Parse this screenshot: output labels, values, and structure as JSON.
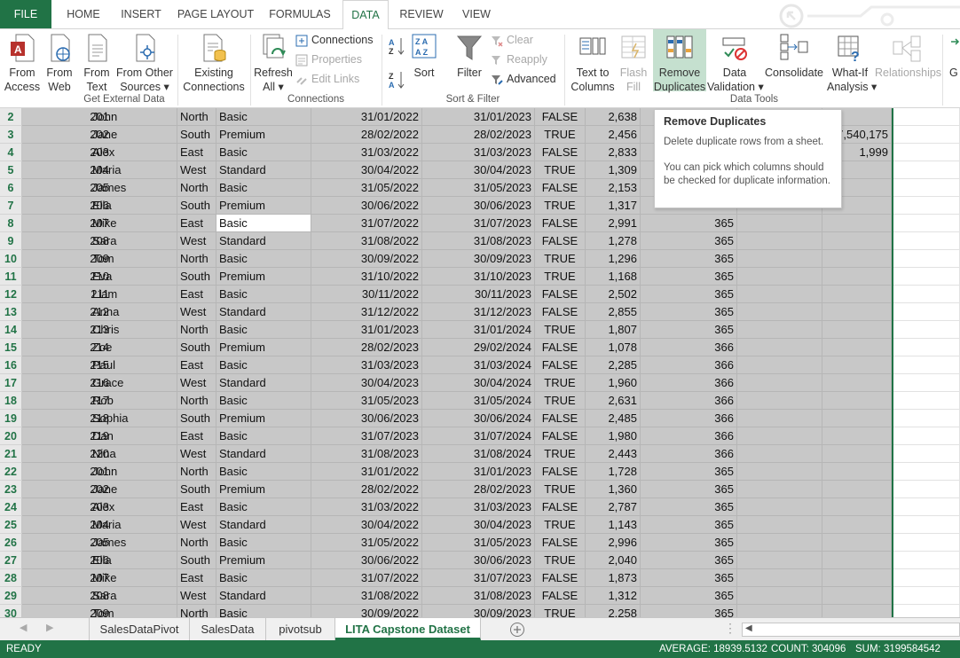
{
  "ribbon_tabs": [
    "FILE",
    "HOME",
    "INSERT",
    "PAGE LAYOUT",
    "FORMULAS",
    "DATA",
    "REVIEW",
    "VIEW"
  ],
  "ribbon": {
    "get_external": {
      "from_access": [
        "From",
        "Access"
      ],
      "from_web": [
        "From",
        "Web"
      ],
      "from_text": [
        "From",
        "Text"
      ],
      "from_other": [
        "From Other",
        "Sources ▾"
      ],
      "existing": [
        "Existing",
        "Connections"
      ],
      "label": "Get External Data"
    },
    "connections": {
      "refresh": [
        "Refresh",
        "All ▾"
      ],
      "connections": "Connections",
      "properties": "Properties",
      "edit_links": "Edit Links",
      "label": "Connections"
    },
    "sort_filter": {
      "sort": "Sort",
      "filter": "Filter",
      "clear": "Clear",
      "reapply": "Reapply",
      "advanced": "Advanced",
      "label": "Sort & Filter"
    },
    "data_tools": {
      "text_to_columns": [
        "Text to",
        "Columns"
      ],
      "flash_fill": [
        "Flash",
        "Fill"
      ],
      "remove_duplicates": [
        "Remove",
        "Duplicates"
      ],
      "data_validation": [
        "Data",
        "Validation ▾"
      ],
      "consolidate": "Consolidate",
      "what_if": [
        "What-If",
        "Analysis ▾"
      ],
      "relationships": "Relationships",
      "label": "Data Tools"
    },
    "group_partial": "G"
  },
  "tooltip": {
    "title": "Remove Duplicates",
    "body": "Delete duplicate rows from a sheet.",
    "body2": "You can pick which columns should be checked for duplicate information."
  },
  "rows": [
    {
      "n": "2",
      "id": "201",
      "name": "John",
      "region": "North",
      "plan": "Basic",
      "start": "31/01/2022",
      "end": "31/01/2023",
      "flag": "FALSE",
      "amount": "2,638",
      "days": "",
      "extra": ""
    },
    {
      "n": "3",
      "id": "202",
      "name": "Jane",
      "region": "South",
      "plan": "Premium",
      "start": "28/02/2022",
      "end": "28/02/2023",
      "flag": "TRUE",
      "amount": "2,456",
      "days": "",
      "extra": "7,540,175"
    },
    {
      "n": "4",
      "id": "203",
      "name": "Alex",
      "region": "East",
      "plan": "Basic",
      "start": "31/03/2022",
      "end": "31/03/2023",
      "flag": "FALSE",
      "amount": "2,833",
      "days": "",
      "extra": "1,999"
    },
    {
      "n": "5",
      "id": "204",
      "name": "Maria",
      "region": "West",
      "plan": "Standard",
      "start": "30/04/2022",
      "end": "30/04/2023",
      "flag": "TRUE",
      "amount": "1,309",
      "days": "",
      "extra": ""
    },
    {
      "n": "6",
      "id": "205",
      "name": "James",
      "region": "North",
      "plan": "Basic",
      "start": "31/05/2022",
      "end": "31/05/2023",
      "flag": "FALSE",
      "amount": "2,153",
      "days": "",
      "extra": ""
    },
    {
      "n": "7",
      "id": "206",
      "name": "Ella",
      "region": "South",
      "plan": "Premium",
      "start": "30/06/2022",
      "end": "30/06/2023",
      "flag": "TRUE",
      "amount": "1,317",
      "days": "",
      "extra": ""
    },
    {
      "n": "8",
      "id": "207",
      "name": "Mike",
      "region": "East",
      "plan": "Basic",
      "start": "31/07/2022",
      "end": "31/07/2023",
      "flag": "FALSE",
      "amount": "2,991",
      "days": "365",
      "extra": ""
    },
    {
      "n": "9",
      "id": "208",
      "name": "Sara",
      "region": "West",
      "plan": "Standard",
      "start": "31/08/2022",
      "end": "31/08/2023",
      "flag": "FALSE",
      "amount": "1,278",
      "days": "365",
      "extra": ""
    },
    {
      "n": "10",
      "id": "209",
      "name": "Tom",
      "region": "North",
      "plan": "Basic",
      "start": "30/09/2022",
      "end": "30/09/2023",
      "flag": "TRUE",
      "amount": "1,296",
      "days": "365",
      "extra": ""
    },
    {
      "n": "11",
      "id": "210",
      "name": "Eva",
      "region": "South",
      "plan": "Premium",
      "start": "31/10/2022",
      "end": "31/10/2023",
      "flag": "TRUE",
      "amount": "1,168",
      "days": "365",
      "extra": ""
    },
    {
      "n": "12",
      "id": "211",
      "name": "Liam",
      "region": "East",
      "plan": "Basic",
      "start": "30/11/2022",
      "end": "30/11/2023",
      "flag": "FALSE",
      "amount": "2,502",
      "days": "365",
      "extra": ""
    },
    {
      "n": "13",
      "id": "212",
      "name": "Anna",
      "region": "West",
      "plan": "Standard",
      "start": "31/12/2022",
      "end": "31/12/2023",
      "flag": "FALSE",
      "amount": "2,855",
      "days": "365",
      "extra": ""
    },
    {
      "n": "14",
      "id": "213",
      "name": "Chris",
      "region": "North",
      "plan": "Basic",
      "start": "31/01/2023",
      "end": "31/01/2024",
      "flag": "TRUE",
      "amount": "1,807",
      "days": "365",
      "extra": ""
    },
    {
      "n": "15",
      "id": "214",
      "name": "Zoe",
      "region": "South",
      "plan": "Premium",
      "start": "28/02/2023",
      "end": "29/02/2024",
      "flag": "FALSE",
      "amount": "1,078",
      "days": "366",
      "extra": ""
    },
    {
      "n": "16",
      "id": "215",
      "name": "Paul",
      "region": "East",
      "plan": "Basic",
      "start": "31/03/2023",
      "end": "31/03/2024",
      "flag": "FALSE",
      "amount": "2,285",
      "days": "366",
      "extra": ""
    },
    {
      "n": "17",
      "id": "216",
      "name": "Grace",
      "region": "West",
      "plan": "Standard",
      "start": "30/04/2023",
      "end": "30/04/2024",
      "flag": "TRUE",
      "amount": "1,960",
      "days": "366",
      "extra": ""
    },
    {
      "n": "18",
      "id": "217",
      "name": "Rob",
      "region": "North",
      "plan": "Basic",
      "start": "31/05/2023",
      "end": "31/05/2024",
      "flag": "TRUE",
      "amount": "2,631",
      "days": "366",
      "extra": ""
    },
    {
      "n": "19",
      "id": "218",
      "name": "Sophia",
      "region": "South",
      "plan": "Premium",
      "start": "30/06/2023",
      "end": "30/06/2024",
      "flag": "FALSE",
      "amount": "2,485",
      "days": "366",
      "extra": ""
    },
    {
      "n": "20",
      "id": "219",
      "name": "Dan",
      "region": "East",
      "plan": "Basic",
      "start": "31/07/2023",
      "end": "31/07/2024",
      "flag": "FALSE",
      "amount": "1,980",
      "days": "366",
      "extra": ""
    },
    {
      "n": "21",
      "id": "220",
      "name": "Nina",
      "region": "West",
      "plan": "Standard",
      "start": "31/08/2023",
      "end": "31/08/2024",
      "flag": "TRUE",
      "amount": "2,443",
      "days": "366",
      "extra": ""
    },
    {
      "n": "22",
      "id": "201",
      "name": "John",
      "region": "North",
      "plan": "Basic",
      "start": "31/01/2022",
      "end": "31/01/2023",
      "flag": "FALSE",
      "amount": "1,728",
      "days": "365",
      "extra": ""
    },
    {
      "n": "23",
      "id": "202",
      "name": "Jane",
      "region": "South",
      "plan": "Premium",
      "start": "28/02/2022",
      "end": "28/02/2023",
      "flag": "TRUE",
      "amount": "1,360",
      "days": "365",
      "extra": ""
    },
    {
      "n": "24",
      "id": "203",
      "name": "Alex",
      "region": "East",
      "plan": "Basic",
      "start": "31/03/2022",
      "end": "31/03/2023",
      "flag": "FALSE",
      "amount": "2,787",
      "days": "365",
      "extra": ""
    },
    {
      "n": "25",
      "id": "204",
      "name": "Maria",
      "region": "West",
      "plan": "Standard",
      "start": "30/04/2022",
      "end": "30/04/2023",
      "flag": "TRUE",
      "amount": "1,143",
      "days": "365",
      "extra": ""
    },
    {
      "n": "26",
      "id": "205",
      "name": "James",
      "region": "North",
      "plan": "Basic",
      "start": "31/05/2022",
      "end": "31/05/2023",
      "flag": "FALSE",
      "amount": "2,996",
      "days": "365",
      "extra": ""
    },
    {
      "n": "27",
      "id": "206",
      "name": "Ella",
      "region": "South",
      "plan": "Premium",
      "start": "30/06/2022",
      "end": "30/06/2023",
      "flag": "TRUE",
      "amount": "2,040",
      "days": "365",
      "extra": ""
    },
    {
      "n": "28",
      "id": "207",
      "name": "Mike",
      "region": "East",
      "plan": "Basic",
      "start": "31/07/2022",
      "end": "31/07/2023",
      "flag": "FALSE",
      "amount": "1,873",
      "days": "365",
      "extra": ""
    },
    {
      "n": "29",
      "id": "208",
      "name": "Sara",
      "region": "West",
      "plan": "Standard",
      "start": "31/08/2022",
      "end": "31/08/2023",
      "flag": "FALSE",
      "amount": "1,312",
      "days": "365",
      "extra": ""
    },
    {
      "n": "30",
      "id": "209",
      "name": "Tom",
      "region": "North",
      "plan": "Basic",
      "start": "30/09/2022",
      "end": "30/09/2023",
      "flag": "TRUE",
      "amount": "2,258",
      "days": "365",
      "extra": ""
    }
  ],
  "sheet_tabs": [
    "SalesDataPivot",
    "SalesData",
    "pivotsub",
    "LITA Capstone Dataset"
  ],
  "active_sheet": "LITA Capstone Dataset",
  "status": {
    "mode": "READY",
    "average": "AVERAGE: 18939.5132",
    "count": "COUNT: 304096",
    "sum": "SUM: 3199584542"
  },
  "colors": {
    "accent": "#217346",
    "selection": "#c8c8c8",
    "top_bar": "#d9161b"
  }
}
